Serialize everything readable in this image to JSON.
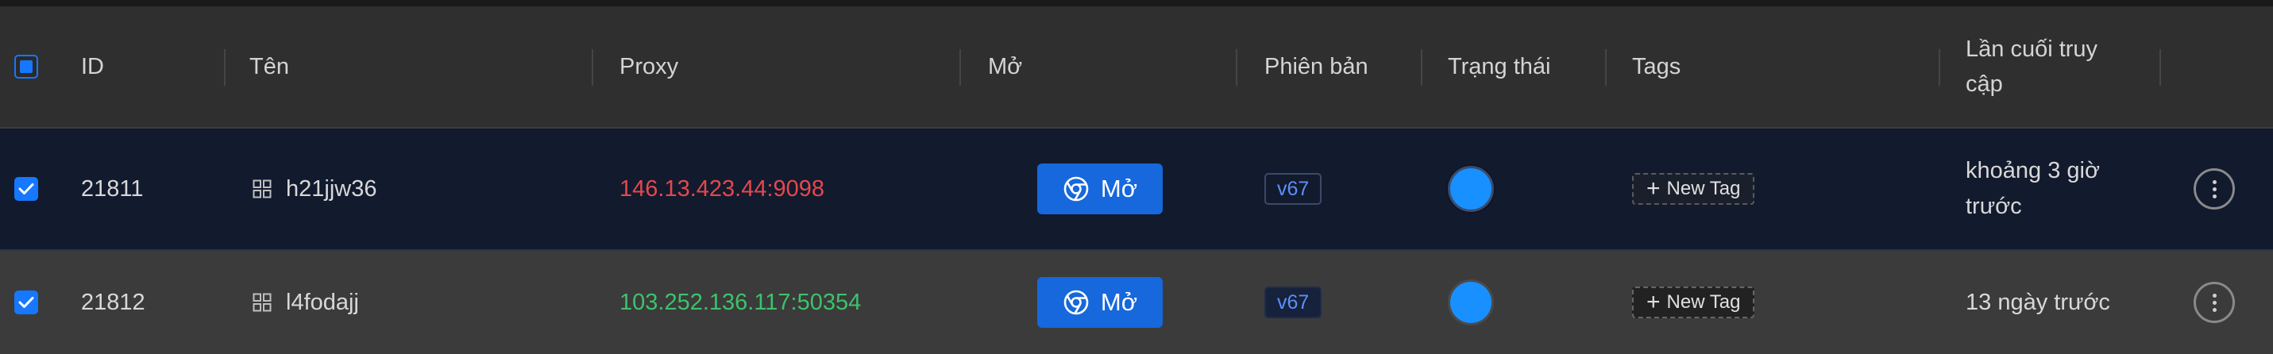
{
  "header": {
    "id": "ID",
    "name": "Tên",
    "proxy": "Proxy",
    "open": "Mở",
    "version": "Phiên bản",
    "status": "Trạng thái",
    "tags": "Tags",
    "last_access_line1": "Lần cuối truy",
    "last_access_line2": "cập"
  },
  "rows": [
    {
      "checked": true,
      "id": "21811",
      "name": "h21jjw36",
      "os_icon": "windows-icon",
      "proxy": "146.13.423.44:9098",
      "proxy_color": "#e5484d",
      "open_label": "Mở",
      "version": "v67",
      "status_color": "#1890ff",
      "new_tag_label": "New Tag",
      "last_access_line1": "khoảng 3 giờ",
      "last_access_line2": "trước"
    },
    {
      "checked": true,
      "id": "21812",
      "name": "l4fodajj",
      "os_icon": "windows-icon",
      "proxy": "103.252.136.117:50354",
      "proxy_color": "#3dc26b",
      "open_label": "Mở",
      "version": "v67",
      "status_color": "#1890ff",
      "new_tag_label": "New Tag",
      "last_access_line1": "13 ngày trước",
      "last_access_line2": ""
    }
  ],
  "colors": {
    "accent": "#1677ff",
    "button": "#1668dc",
    "selected_row_bg": "#121a2e"
  }
}
